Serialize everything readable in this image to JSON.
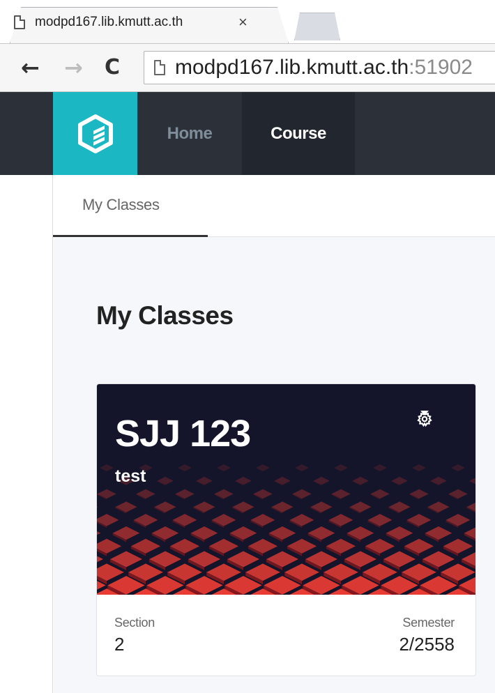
{
  "browser": {
    "tab_title": "modpd167.lib.kmutt.ac.th",
    "tab_close": "×",
    "back_icon": "←",
    "forward_icon": "→",
    "reload_icon": "C",
    "url_host": "modpd167.lib.kmutt.ac.th",
    "url_port": ":51902"
  },
  "nav": {
    "logo": "app-logo",
    "home": "Home",
    "course": "Course"
  },
  "subnav": {
    "my_classes_tab": "My Classes"
  },
  "main": {
    "page_title": "My Classes",
    "cards": [
      {
        "code": "SJJ 123",
        "name": "test",
        "section_label": "Section",
        "section_value": "2",
        "semester_label": "Semester",
        "semester_value": "2/2558"
      }
    ]
  },
  "colors": {
    "appbar": "#2b3039",
    "logo_bg": "#1bb7c3",
    "active_nav": "#22262e",
    "banner_bg": "#14152a",
    "banner_accent": "#e0332e"
  },
  "icons": [
    "page-icon",
    "close-icon",
    "back-arrow-icon",
    "forward-arrow-icon",
    "reload-icon",
    "gear-icon",
    "caret-down-icon"
  ]
}
